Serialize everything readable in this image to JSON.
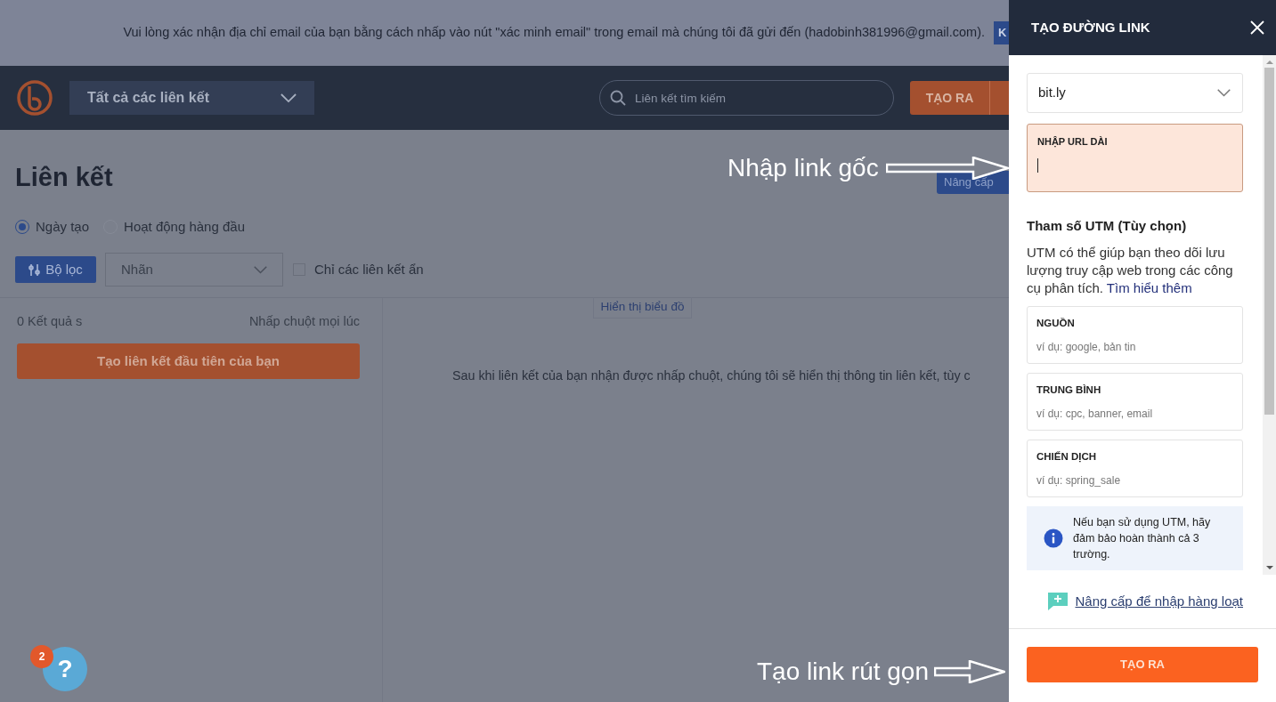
{
  "banner": {
    "text": "Vui lòng xác nhận địa chỉ email của bạn bằng cách nhấp vào nút \"xác minh email\" trong email mà chúng tôi đã gửi đến (hadobinh381996@gmail.com).",
    "button_label": "K"
  },
  "header": {
    "links_dropdown": "Tất cả các liên kết",
    "search_placeholder": "Liên kết tìm kiếm",
    "create_button": "TẠO RA"
  },
  "links_page": {
    "title": "Liên kết",
    "upgrade_button": "Nâng cấp",
    "sort_options": [
      {
        "label": "Ngày tạo",
        "selected": true
      },
      {
        "label": "Hoạt động hàng đầu",
        "selected": false
      }
    ],
    "filter_button": "Bộ lọc",
    "tag_select": "Nhãn",
    "hidden_only": {
      "label": "Chỉ các liên kết ẩn",
      "checked": false
    },
    "results_count": "0 Kết quả s",
    "clicks_filter": "Nhấp chuột mọi lúc",
    "first_link_button": "Tạo liên kết đầu tiên của bạn",
    "chart_toggle": "Hiển thị biểu đồ",
    "empty_message": "Sau khi liên kết của bạn nhận được nhấp chuột, chúng tôi sẽ hiển thị thông tin liên kết, tùy c"
  },
  "help": {
    "badge": "2",
    "glyph": "?"
  },
  "create_panel": {
    "title": "TẠO ĐƯỜNG LINK",
    "domain": "bit.ly",
    "long_url_label": "NHẬP URL DÀI",
    "utm_heading": "Tham số UTM (Tùy chọn)",
    "utm_description": "UTM có thể giúp bạn theo dõi lưu lượng truy cập web trong các công cụ phân tích.",
    "utm_learn_more": "Tìm hiểu thêm",
    "utm_fields": [
      {
        "label": "NGUỒN",
        "placeholder": "ví dụ: google, bản tin"
      },
      {
        "label": "TRUNG BÌNH",
        "placeholder": "ví dụ: cpc, banner, email"
      },
      {
        "label": "CHIẾN DỊCH",
        "placeholder": "ví dụ: spring_sale"
      }
    ],
    "info": "Nếu bạn sử dụng UTM, hãy đảm bảo hoàn thành cả 3 trường.",
    "bulk_link": "Nâng cấp để nhập hàng loạt",
    "submit_button": "TẠO RA"
  },
  "annotations": [
    {
      "text": "Nhập link gốc",
      "kind": "url"
    },
    {
      "text": "Tạo link rút gọn",
      "kind": "submit"
    }
  ]
}
